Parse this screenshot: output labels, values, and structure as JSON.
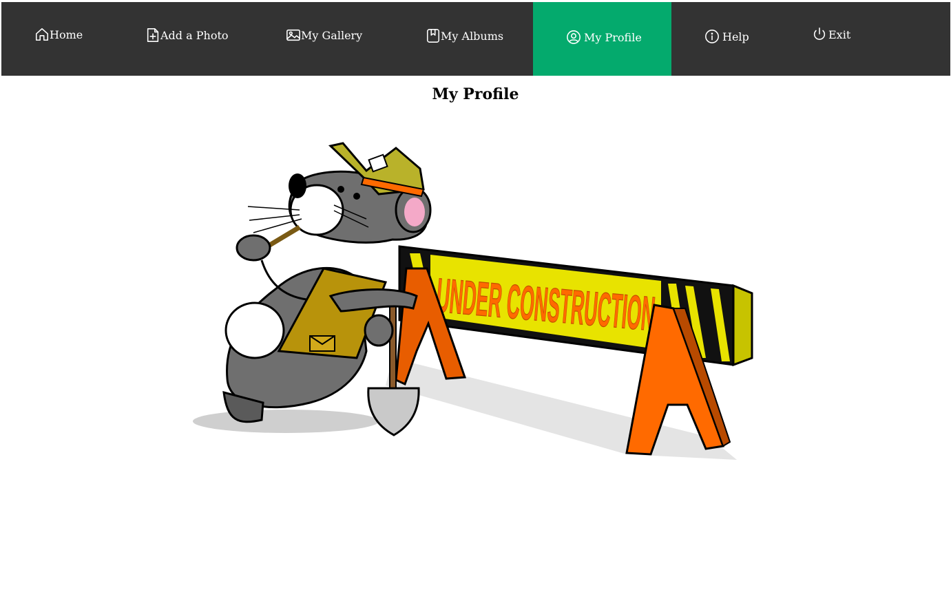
{
  "nav": {
    "items": [
      {
        "label": "Home",
        "icon": "home-icon"
      },
      {
        "label": "Add a Photo",
        "icon": "add-photo-icon"
      },
      {
        "label": "My Gallery",
        "icon": "image-icon"
      },
      {
        "label": "My Albums",
        "icon": "bookmark-icon"
      },
      {
        "label": "My Profile",
        "icon": "user-circle-icon",
        "active": true
      },
      {
        "label": "Help",
        "icon": "info-icon"
      },
      {
        "label": "Exit",
        "icon": "power-icon"
      }
    ],
    "bg_color": "#333333",
    "active_color": "#04aa6d"
  },
  "page": {
    "title": "My Profile"
  },
  "illustration": {
    "banner_text": "UNDER CONSTRUCTION"
  }
}
